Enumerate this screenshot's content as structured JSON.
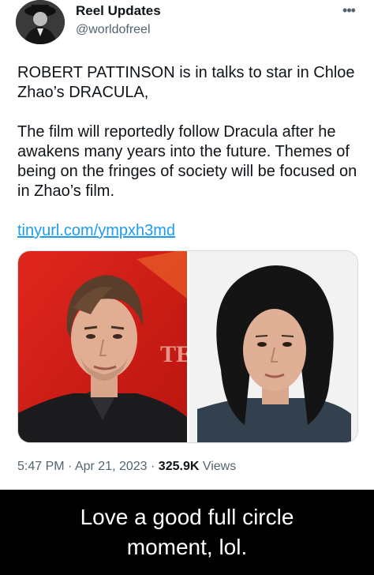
{
  "tweet": {
    "display_name": "Reel Updates",
    "handle": "@worldofreel",
    "more_label": "•••",
    "paragraph_1": "ROBERT PATTINSON is in talks to star in Chloe Zhao’s DRACULA,",
    "paragraph_2": "The film will reportedly follow Dracula after he awakens many years into the future. Themes of being on the fringes of society will be focused on in Zhao’s film.",
    "link": "tinyurl.com/ympxh3md",
    "time": "5:47 PM",
    "separator": "·",
    "date": "Apr 21, 2023",
    "views_count": "325.9K",
    "views_label": "Views"
  },
  "caption": {
    "text": "Love a good full circle moment, lol."
  },
  "colors": {
    "link": "#1d9bf0",
    "secondary_text": "#536471",
    "primary_text": "#0f1419",
    "caption_background": "#000000",
    "left_photo_background": "#d9231c"
  },
  "media": {
    "left_photo": "photo-man",
    "right_photo": "photo-woman",
    "left_backdrop_text": "TER"
  }
}
